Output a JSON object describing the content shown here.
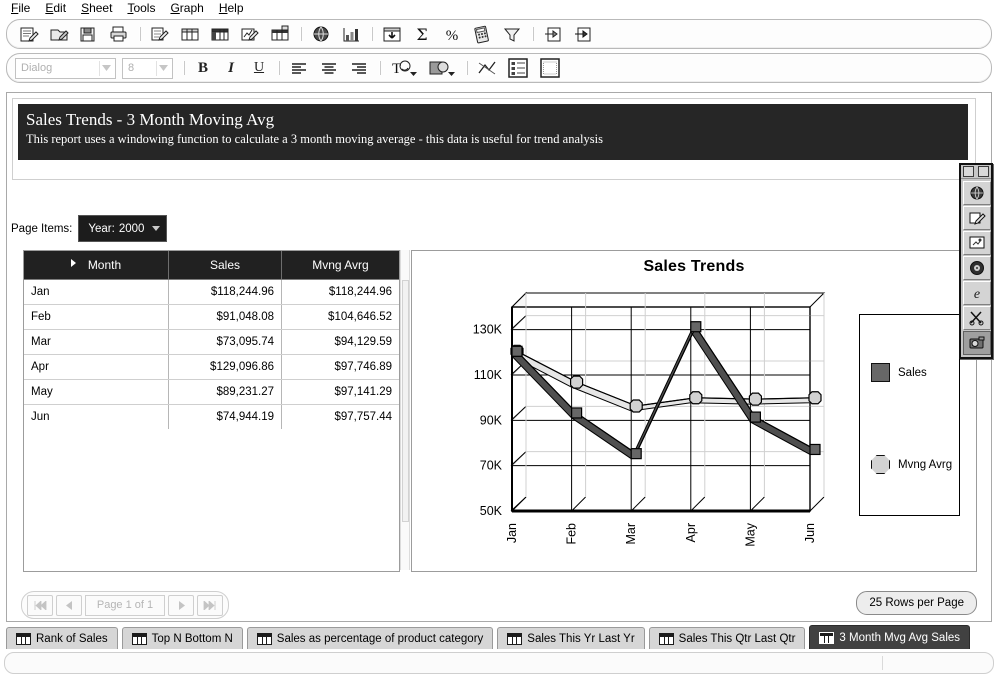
{
  "menu": {
    "items": [
      {
        "pre": "F",
        "mnemonic": "",
        "label": "File"
      },
      {
        "label": "Edit"
      },
      {
        "label": "Sheet"
      },
      {
        "label": "Tools"
      },
      {
        "label": "Graph"
      },
      {
        "label": "Help"
      }
    ]
  },
  "toolbar_main": {
    "buttons": [
      {
        "name": "new-worksheet-icon",
        "tip": "New"
      },
      {
        "name": "open-workbook-icon",
        "tip": "Open"
      },
      {
        "name": "save-workbook-icon",
        "tip": "Save"
      },
      {
        "name": "print-icon",
        "tip": "Print"
      },
      {
        "name": "separator-1",
        "tip": ""
      },
      {
        "name": "edit-sheet-icon",
        "tip": "Edit Sheet"
      },
      {
        "name": "table-layout-icon",
        "tip": "Table"
      },
      {
        "name": "crosstab-layout-icon",
        "tip": "Crosstab"
      },
      {
        "name": "edit-graph-icon",
        "tip": "Edit Graph"
      },
      {
        "name": "page-detail-icon",
        "tip": "Page Detail"
      },
      {
        "name": "separator-2",
        "tip": ""
      },
      {
        "name": "globe-drill-icon",
        "tip": "Drill"
      },
      {
        "name": "bar-graph-icon",
        "tip": "Graph"
      },
      {
        "name": "separator-3",
        "tip": ""
      },
      {
        "name": "sort-down-icon",
        "tip": "Sort"
      },
      {
        "name": "total-sigma-icon",
        "tip": "Totals"
      },
      {
        "name": "percent-icon",
        "tip": "Percentage"
      },
      {
        "name": "calculation-icon",
        "tip": "Calculation"
      },
      {
        "name": "condition-filter-icon",
        "tip": "Conditions"
      },
      {
        "name": "separator-4",
        "tip": ""
      },
      {
        "name": "export-icon",
        "tip": "Export"
      },
      {
        "name": "send-icon",
        "tip": "Send"
      }
    ]
  },
  "toolbar_format": {
    "font_name": "Dialog",
    "font_size": "8",
    "bold_label": "B",
    "italic_label": "I",
    "underline_label": "U",
    "buttons": [
      {
        "name": "align-left-icon"
      },
      {
        "name": "align-center-icon"
      },
      {
        "name": "align-right-icon"
      },
      {
        "name": "separator-5"
      },
      {
        "name": "text-color-icon"
      },
      {
        "name": "fill-color-icon"
      },
      {
        "name": "separator-6"
      },
      {
        "name": "graph-format-icon"
      },
      {
        "name": "table-format-icon"
      },
      {
        "name": "grid-format-icon"
      }
    ]
  },
  "report": {
    "title": "Sales Trends - 3 Month Moving Avg",
    "description": "This report uses a windowing function to calculate a 3 month moving average - this data is useful for trend analysis"
  },
  "page_items": {
    "label": "Page Items:",
    "dropdown_label": "Year:",
    "dropdown_value": "2000"
  },
  "table": {
    "columns": [
      "Month",
      "Sales",
      "Mvng Avrg"
    ],
    "rows": [
      {
        "month": "Jan",
        "sales": "$118,244.96",
        "mvng": "$118,244.96"
      },
      {
        "month": "Feb",
        "sales": "$91,048.08",
        "mvng": "$104,646.52"
      },
      {
        "month": "Mar",
        "sales": "$73,095.74",
        "mvng": "$94,129.59"
      },
      {
        "month": "Apr",
        "sales": "$129,096.86",
        "mvng": "$97,746.89"
      },
      {
        "month": "May",
        "sales": "$89,231.27",
        "mvng": "$97,141.29"
      },
      {
        "month": "Jun",
        "sales": "$74,944.19",
        "mvng": "$97,757.44"
      }
    ]
  },
  "chart_data": {
    "type": "line",
    "title": "Sales Trends",
    "xlabel": "",
    "ylabel": "",
    "categories": [
      "Jan",
      "Feb",
      "Mar",
      "Apr",
      "May",
      "Jun"
    ],
    "ylim": [
      50000,
      140000
    ],
    "yticks": [
      50000,
      70000,
      90000,
      110000,
      130000
    ],
    "ytick_labels": [
      "50K",
      "70K",
      "90K",
      "110K",
      "130K"
    ],
    "grid": true,
    "legend_position": "right",
    "series": [
      {
        "name": "Sales",
        "color": "#676767",
        "marker": "square",
        "values": [
          118244.96,
          91048.08,
          73095.74,
          129096.86,
          89231.27,
          74944.19
        ]
      },
      {
        "name": "Mvng Avrg",
        "color": "#d2d2d2",
        "marker": "octagon",
        "values": [
          118244.96,
          104646.52,
          94129.59,
          97746.89,
          97141.29,
          97757.44
        ]
      }
    ]
  },
  "pager": {
    "first_label": "|◀◀",
    "prev_label": "◀",
    "page_label": "Page 1 of 1",
    "next_label": "▶",
    "last_label": "▶▶|",
    "rows_per_page_label": "25 Rows per Page"
  },
  "tabs": [
    {
      "label": "Rank of Sales",
      "active": false
    },
    {
      "label": "Top N Bottom N",
      "active": false
    },
    {
      "label": "Sales as percentage of product category",
      "active": false
    },
    {
      "label": "Sales This Yr Last Yr",
      "active": false
    },
    {
      "label": "Sales This Qtr Last Qtr",
      "active": false
    },
    {
      "label": "3 Month Mvg Avg Sales",
      "active": true
    }
  ],
  "palette": {
    "items": [
      {
        "name": "globe-tool-icon"
      },
      {
        "name": "pencil-edit-tool-icon"
      },
      {
        "name": "screen-tool-icon"
      },
      {
        "name": "disc-tool-icon"
      },
      {
        "name": "browser-tool-icon"
      },
      {
        "name": "scissors-tool-icon"
      },
      {
        "name": "camera-tool-icon",
        "selected": true
      }
    ]
  },
  "colors": {
    "header_dark": "#212121",
    "title_bar": "#262626",
    "series_sales": "#676767",
    "series_mvng": "#d2d2d2",
    "active_tab": "#414141"
  }
}
